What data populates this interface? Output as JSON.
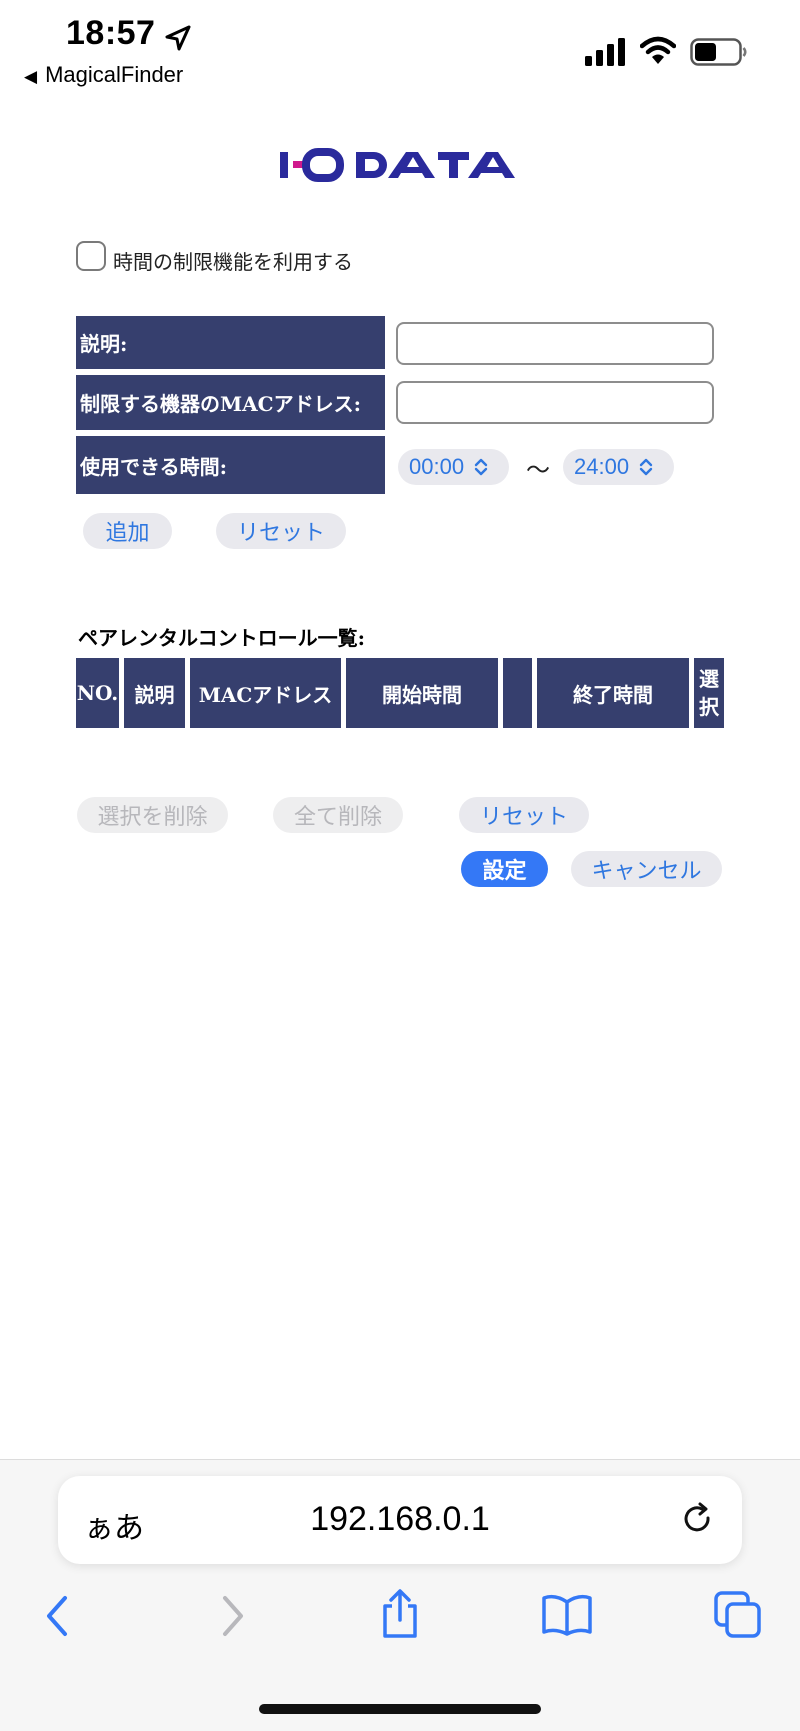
{
  "status_bar": {
    "time": "18:57",
    "back_app": "MagicalFinder"
  },
  "brand": {
    "logo_text": "I·O DATA",
    "logo_color": "#2a2a9c",
    "accent_magenta": "#d0198d"
  },
  "form": {
    "enable_label": "時間の制限機能を利用する",
    "description_label": "説明:",
    "mac_label": "制限する機器のMACアドレス:",
    "time_label": "使用できる時間:",
    "start_time": "00:00",
    "separator": "～",
    "end_time": "24:00",
    "add_button": "追加",
    "reset_button": "リセット"
  },
  "list": {
    "title": "ペアレンタルコントロール一覧:",
    "columns": [
      "NO.",
      "説明",
      "MACアドレス",
      "開始時間",
      "",
      "終了時間",
      "選",
      "択"
    ]
  },
  "actions": {
    "delete_selected": "選択を削除",
    "delete_all": "全て削除",
    "reset": "リセット",
    "apply": "設定",
    "cancel": "キャンセル"
  },
  "browser": {
    "aa_label": "ぁあ",
    "url": "192.168.0.1"
  },
  "colors": {
    "header_bg": "#363f6e",
    "link_blue": "#2f77e0",
    "primary_blue": "#3478f6"
  }
}
